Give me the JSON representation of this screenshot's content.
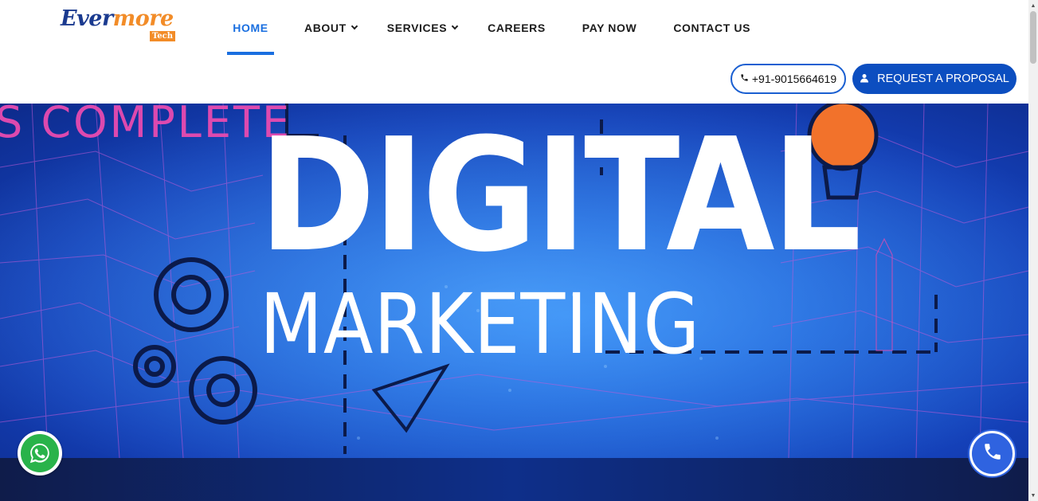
{
  "brand": {
    "name_part1": "Ever",
    "name_part2": "more",
    "tag": "Tech"
  },
  "nav": {
    "items": [
      {
        "label": "HOME",
        "active": true,
        "dropdown": false
      },
      {
        "label": "ABOUT",
        "active": false,
        "dropdown": true
      },
      {
        "label": "SERVICES",
        "active": false,
        "dropdown": true
      },
      {
        "label": "CAREERS",
        "active": false,
        "dropdown": false
      },
      {
        "label": "PAY NOW",
        "active": false,
        "dropdown": false
      },
      {
        "label": "CONTACT US",
        "active": false,
        "dropdown": false
      }
    ]
  },
  "header_actions": {
    "phone_label": "+91-9015664619",
    "phone_icon": "phone-icon",
    "proposal_label": "REQUEST A PROPOSAL",
    "proposal_icon": "user-icon"
  },
  "banner": {
    "heading_main": "DIGITAL",
    "heading_sub": "MARKETING",
    "background_text": "S COMPLETE"
  },
  "floating": {
    "whatsapp_icon": "whatsapp-icon",
    "call_icon": "phone-icon"
  },
  "colors": {
    "accent": "#1a6fe0",
    "button_primary": "#0c4ec0",
    "logo_orange": "#f28c28",
    "logo_navy": "#1a3a8f",
    "whatsapp_green": "#29b34a"
  }
}
